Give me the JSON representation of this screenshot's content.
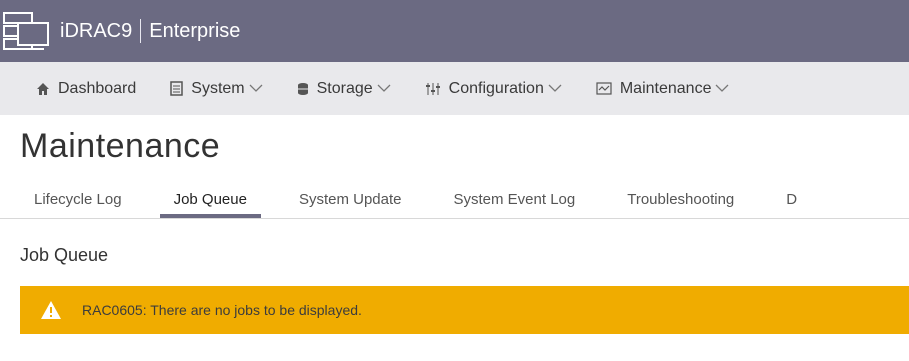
{
  "app": {
    "brand_name": "iDRAC9",
    "edition": "Enterprise"
  },
  "nav": {
    "items": [
      {
        "label": "Dashboard",
        "icon": "home-icon",
        "has_menu": false
      },
      {
        "label": "System",
        "icon": "system-icon",
        "has_menu": true
      },
      {
        "label": "Storage",
        "icon": "storage-icon",
        "has_menu": true
      },
      {
        "label": "Configuration",
        "icon": "sliders-icon",
        "has_menu": true
      },
      {
        "label": "Maintenance",
        "icon": "maintenance-icon",
        "has_menu": true
      }
    ]
  },
  "page": {
    "title": "Maintenance"
  },
  "tabs": [
    {
      "label": "Lifecycle Log",
      "active": false
    },
    {
      "label": "Job Queue",
      "active": true
    },
    {
      "label": "System Update",
      "active": false
    },
    {
      "label": "System Event Log",
      "active": false
    },
    {
      "label": "Troubleshooting",
      "active": false
    },
    {
      "label": "D",
      "active": false
    }
  ],
  "section": {
    "title": "Job Queue"
  },
  "alert": {
    "message": "RAC0605: There are no jobs to be displayed.",
    "color": "#f0ac00"
  },
  "colors": {
    "header": "#6b6a82",
    "nav": "#e9e9ec"
  }
}
